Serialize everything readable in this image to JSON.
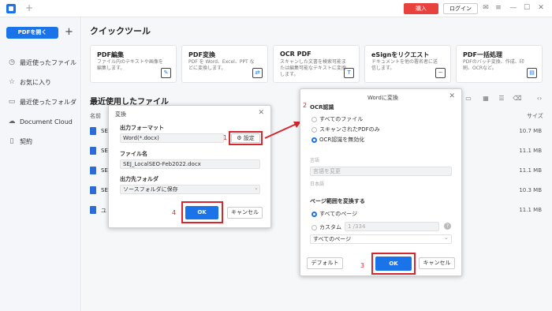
{
  "titlebar": {
    "buy_label": "購入",
    "login_label": "ログイン",
    "tab_add": "+",
    "minimize": "—",
    "maximize": "☐",
    "close": "✕"
  },
  "sidebar": {
    "open_pdf": "PDFを開く",
    "add": "+",
    "items": [
      {
        "label": "最近使ったファイル",
        "icon": "clock-icon"
      },
      {
        "label": "お気に入り",
        "icon": "star-icon"
      },
      {
        "label": "最近使ったフォルダ",
        "icon": "folder-icon"
      },
      {
        "label": "Document Cloud",
        "icon": "cloud-icon"
      },
      {
        "label": "契約",
        "icon": "document-icon"
      }
    ]
  },
  "main": {
    "quick_tools_title": "クイックツール",
    "cards": [
      {
        "title": "PDF編集",
        "desc": "ファイル内のテキストや画像を編集します。",
        "icon": "edit-icon"
      },
      {
        "title": "PDF変換",
        "desc": "PDF を Word、Excel、PPT などに変換します。",
        "icon": "convert-icon"
      },
      {
        "title": "OCR PDF",
        "desc": "スキャンした文書を検索可能または編集可能なテキストに変換します。",
        "icon": "ocr-icon"
      },
      {
        "title": "eSignをリクエスト",
        "desc": "ドキュメントを他の署名者に送信します。",
        "icon": "esign-icon"
      },
      {
        "title": "PDF一括処理",
        "desc": "PDFのバッチ変換、作成、印刷、OCRなど。",
        "icon": "batch-icon"
      }
    ],
    "recent_title": "最近使用したファイル",
    "col_name": "名前",
    "col_size": "サイズ",
    "files": [
      {
        "name": "SE",
        "size": "10.7 MB"
      },
      {
        "name": "SE",
        "size": "11.1 MB"
      },
      {
        "name": "SE",
        "size": "11.1 MB"
      },
      {
        "name": "SE",
        "size": "10.3 MB"
      },
      {
        "name": "ユ",
        "size": "11.1 MB"
      }
    ]
  },
  "convert_dialog": {
    "title": "変換",
    "close": "✕",
    "output_format_label": "出力フォーマット",
    "output_format_value": "Word(*.docx)",
    "settings_button": "設定",
    "file_name_label": "ファイル名",
    "file_name_value": "SEJ_LocalSEO-Feb2022.docx",
    "output_folder_label": "出力先フォルダ",
    "output_folder_value": "ソースフォルダに保存",
    "ok": "OK",
    "cancel": "キャンセル",
    "step1": "1",
    "step4": "4"
  },
  "word_dialog": {
    "title": "Wordに変換",
    "close": "✕",
    "ocr_label": "OCR認識",
    "step2": "2",
    "step3": "3",
    "ocr_options": [
      "すべてのファイル",
      "スキャンされたPDFのみ",
      "OCR認識を無効化"
    ],
    "lang_label": "言語",
    "lang_placeholder": "言語を変更",
    "lang_value": "日本語",
    "page_range_label": "ページ範囲を変換する",
    "all_pages": "すべてのページ",
    "custom": "カスタム",
    "custom_value": "1 /334",
    "page_select": "すべてのページ",
    "default_button": "デフォルト",
    "ok": "OK",
    "cancel": "キャンセル"
  },
  "colors": {
    "accent": "#1a73e8",
    "highlight": "#d6262e"
  }
}
